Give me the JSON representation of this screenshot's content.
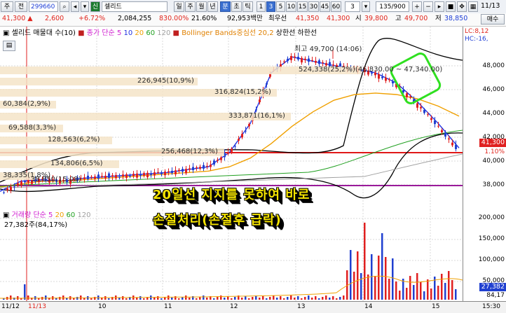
{
  "toolbar": {
    "stock_type": "주",
    "prev_label": "전",
    "code": "299660",
    "market_badge": "신",
    "name": "셀리드",
    "periods": [
      "일",
      "주",
      "월",
      "년",
      "분",
      "초",
      "틱"
    ],
    "selected_period": "분",
    "intervals": [
      "1",
      "3",
      "5",
      "10",
      "15",
      "30",
      "45",
      "60"
    ],
    "selected_interval": "3",
    "count_value": "3",
    "bars": "135/900",
    "date": "11/13"
  },
  "quote": {
    "price": "41,300",
    "change": "2,600",
    "change_pct": "+6.72%",
    "volume": "2,084,255",
    "volume_ratio": "830.00%",
    "turnover": "21.60%",
    "amount": "92,953백만",
    "uptick_label": "최우선",
    "bid": "41,350",
    "ask": "41,300",
    "open_label": "시",
    "open": "39,800",
    "high_label": "고",
    "high": "49,700",
    "low_label": "저",
    "low": "38,850",
    "buy_label": "매수"
  },
  "price_pane": {
    "legend_name": "셀리드 매물대 수(10)",
    "legend_ma_label": "종가 단순",
    "ma_periods": [
      "5",
      "10",
      "20",
      "60",
      "120"
    ],
    "ma_colors": [
      "#d020d0",
      "#2030e0",
      "#f0a000",
      "#20a020",
      "#a0a0a0"
    ],
    "bollinger": "Bollinger Bands중심선 20,2",
    "upper_lower": "상한선 하한선",
    "lc": "LC:8,12",
    "hc": "HC:-16,",
    "high_note": "최고 49,700 (14:06)",
    "range_note": "524,338(25,2%)(46,830.00 ~ 47,340.00)",
    "low_note": "38,850(15:08)",
    "volume_profile": [
      {
        "label": "226,945(10,9%)"
      },
      {
        "label": "316,824(15,2%)"
      },
      {
        "label": "60,384(2,9%)"
      },
      {
        "label": "333,871(16,1%)"
      },
      {
        "label": "69,588(3,3%)"
      },
      {
        "label": "128,563(6,2%)"
      },
      {
        "label": "256,468(12,3%)"
      },
      {
        "label": "134,806(6,5%)"
      },
      {
        "label": "38,335(1,8%)"
      }
    ],
    "y_ticks": [
      "48,000",
      "46,000",
      "44,000",
      "42,000",
      "40,000",
      "38,000"
    ],
    "current_price_tag": "41,300",
    "pct_tag": "1.10%",
    "annotation": [
      "20일선 지지를 못하여 바로",
      "손절처리(손절후 급락)"
    ]
  },
  "volume_pane": {
    "legend_label": "거래량",
    "legend_ma_label": "단순",
    "ma_periods": [
      "5",
      "20",
      "60",
      "120"
    ],
    "value_line": "27,382주(84,17%)",
    "y_ticks": [
      "200,000",
      "150,000",
      "100,000",
      "50,000"
    ],
    "current_tag": "27,382",
    "current_tag2": "84,17"
  },
  "x_axis": {
    "labels": [
      "11/12",
      "11/13",
      "10",
      "11",
      "12",
      "13",
      "14",
      "15"
    ],
    "time_label": "15:30"
  },
  "chart_data": {
    "type": "line",
    "x_labels": [
      "10",
      "11",
      "12",
      "13",
      "14",
      "15"
    ],
    "ylim": [
      37000,
      49700
    ],
    "series": [
      {
        "name": "5",
        "values": [
          38300,
          39000,
          39100,
          39000,
          39200,
          39300,
          39400,
          39500,
          39600,
          39800,
          40000,
          41000,
          43000,
          46500,
          47600,
          47300,
          47000,
          46800,
          46500,
          45800,
          44500,
          43000,
          41300
        ]
      },
      {
        "name": "20",
        "values": [
          38600,
          38800,
          39000,
          39000,
          39100,
          39200,
          39300,
          39400,
          39500,
          39600,
          39700,
          40000,
          40600,
          41600,
          42800,
          43800,
          44600,
          45000,
          45100,
          45000,
          44700,
          44200,
          43500
        ]
      }
    ]
  },
  "side_buttons": [
    "매수"
  ]
}
